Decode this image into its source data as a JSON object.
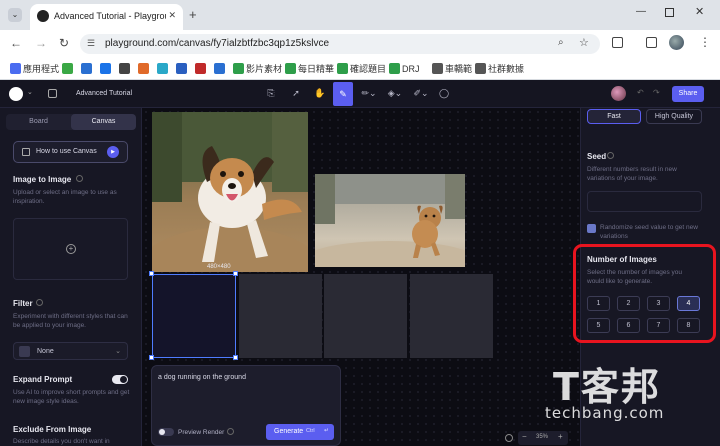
{
  "browser": {
    "tab_title": "Advanced Tutorial - Playgroun",
    "url": "playground.com/canvas/fy7ialzbtfzbc3qp1z5kslvce",
    "bookmarks": [
      {
        "label": "應用程式",
        "color": "#4a6cf0"
      },
      {
        "label": "",
        "color": "#3aa845"
      },
      {
        "label": "",
        "color": "#2a6fd1"
      },
      {
        "label": "",
        "color": "#1a73e8"
      },
      {
        "label": "",
        "color": "#444"
      },
      {
        "label": "",
        "color": "#e06a2a"
      },
      {
        "label": "",
        "color": "#2aa8c8"
      },
      {
        "label": "",
        "color": "#2a5fc0"
      },
      {
        "label": "",
        "color": "#c02a2a"
      },
      {
        "label": "",
        "color": "#2a6fd1"
      },
      {
        "label": "影片素材",
        "color": "#2e9e4a"
      },
      {
        "label": "每日精華",
        "color": "#2e9e4a"
      },
      {
        "label": "確認題目",
        "color": "#2e9e4a"
      },
      {
        "label": "DRJ",
        "color": "#2e9e4a"
      },
      {
        "label": "車轎範",
        "color": "#555"
      },
      {
        "label": "社群數據",
        "color": "#555"
      }
    ]
  },
  "app": {
    "title": "Advanced Tutorial",
    "share_label": "Share"
  },
  "left": {
    "tabs": [
      "Board",
      "Canvas"
    ],
    "how_to": "How to use Canvas",
    "image_to_image_title": "Image to Image",
    "image_to_image_desc": "Upload or select an image to use as inspiration.",
    "filter_title": "Filter",
    "filter_desc": "Experiment with different styles that can be applied to your image.",
    "filter_value": "None",
    "expand_title": "Expand Prompt",
    "expand_desc": "Use AI to improve short prompts and get new image style ideas.",
    "exclude_title": "Exclude From Image",
    "exclude_desc": "Describe details you don't want in"
  },
  "canvas": {
    "size_label": "480×480",
    "prompt": "a dog running on the ground",
    "preview_label": "Preview Render",
    "generate_label": "Generate",
    "generate_shortcut": "Ctrl",
    "zoom": "35%"
  },
  "right": {
    "quality_options": [
      "Fast",
      "High Quality"
    ],
    "seed_title": "Seed",
    "seed_desc": "Different numbers result in new variations of your image.",
    "randomize_label": "Randomize seed value to get new variations",
    "num_images_title": "Number of Images",
    "num_images_desc": "Select the number of images you would like to generate.",
    "num_options": [
      "1",
      "2",
      "3",
      "4",
      "5",
      "6",
      "7",
      "8"
    ],
    "num_selected": "4"
  },
  "watermark": {
    "brand": "T客邦",
    "site": "techbang.com"
  },
  "colors": {
    "accent": "#5b5ef0",
    "highlight_box": "#e8141f",
    "selection": "#4f7cff"
  }
}
